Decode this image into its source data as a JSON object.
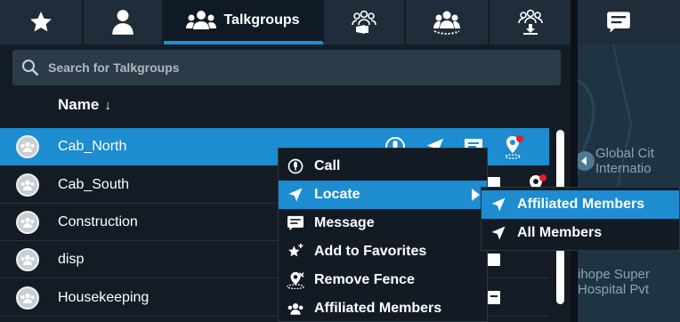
{
  "tabs": [
    {
      "name": "favorites",
      "icon": "star-icon"
    },
    {
      "name": "contacts",
      "icon": "person-icon"
    },
    {
      "name": "talkgroups",
      "icon": "group-icon",
      "label": "Talkgroups",
      "active": true
    },
    {
      "name": "broadcast",
      "icon": "broadcast-group-icon"
    },
    {
      "name": "dynamic",
      "icon": "group-circle-icon"
    },
    {
      "name": "download",
      "icon": "group-download-icon"
    }
  ],
  "search": {
    "placeholder": "Search for Talkgroups"
  },
  "list": {
    "column_header": "Name",
    "sort_indicator": "↓",
    "rows": [
      {
        "name": "Cab_North",
        "selected": true
      },
      {
        "name": "Cab_South"
      },
      {
        "name": "Construction"
      },
      {
        "name": "disp"
      },
      {
        "name": "Housekeeping"
      }
    ]
  },
  "map": {
    "labels": [
      "Global Cit",
      "Internatio",
      "ihope Super",
      "Hospital Pvt"
    ]
  },
  "context_menu": {
    "items": [
      {
        "label": "Call",
        "icon": "call-icon"
      },
      {
        "label": "Locate",
        "icon": "locate-icon",
        "highlighted": true,
        "has_submenu": true
      },
      {
        "label": "Message",
        "icon": "message-icon"
      },
      {
        "label": "Add to Favorites",
        "icon": "add-favorite-icon"
      },
      {
        "label": "Remove Fence",
        "icon": "remove-fence-icon"
      },
      {
        "label": "Affiliated Members",
        "icon": "affiliated-members-icon"
      }
    ]
  },
  "locate_submenu": {
    "items": [
      {
        "label": "Affiliated Members",
        "highlighted": true
      },
      {
        "label": "All Members"
      }
    ]
  },
  "colors": {
    "accent": "#1d8cd0",
    "panel_bg": "#131c25",
    "alert": "#e8192c"
  }
}
